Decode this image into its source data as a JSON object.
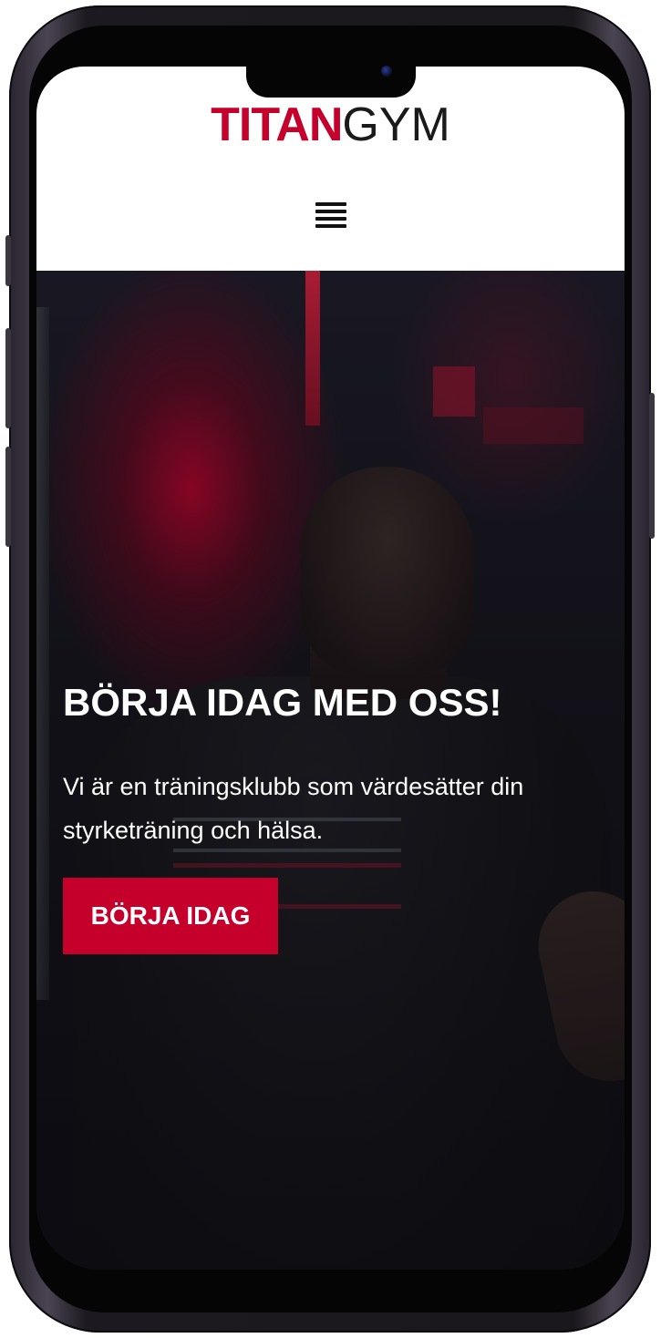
{
  "brand": {
    "logo_part1": "TITAN",
    "logo_part2": "GYM",
    "primary_color": "#c4002b"
  },
  "header": {
    "menu_icon": "hamburger-menu-icon"
  },
  "hero": {
    "title": "BÖRJA IDAG MED OSS!",
    "description": "Vi är en träningsklubb som värdesätter din styrketräning och hälsa.",
    "cta_label": "BÖRJA IDAG",
    "background_image": "man-in-black-shirt-gym-photo"
  }
}
